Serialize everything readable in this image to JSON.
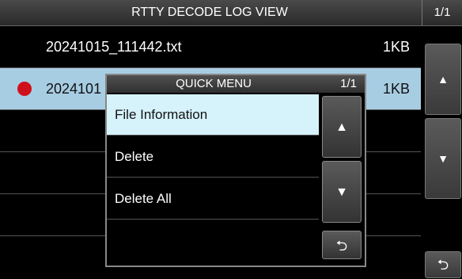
{
  "window": {
    "title": "RTTY DECODE LOG VIEW",
    "page": "1/1"
  },
  "files": [
    {
      "name": "20241015_111442.txt",
      "size": "1KB",
      "selected": false
    },
    {
      "name": "2024101",
      "size": "1KB",
      "selected": true
    }
  ],
  "side_buttons": {
    "up": "▲",
    "down": "▼",
    "back": "⮌"
  },
  "quick_menu": {
    "title": "QUICK MENU",
    "page": "1/1",
    "items": [
      "File Information",
      "Delete",
      "Delete All"
    ],
    "buttons": {
      "up": "▲",
      "down": "▼",
      "back": "⮌"
    }
  },
  "colors": {
    "selected_row": "#a7cde3",
    "active_item": "#d6f2fb",
    "record_dot": "#d0101a"
  }
}
